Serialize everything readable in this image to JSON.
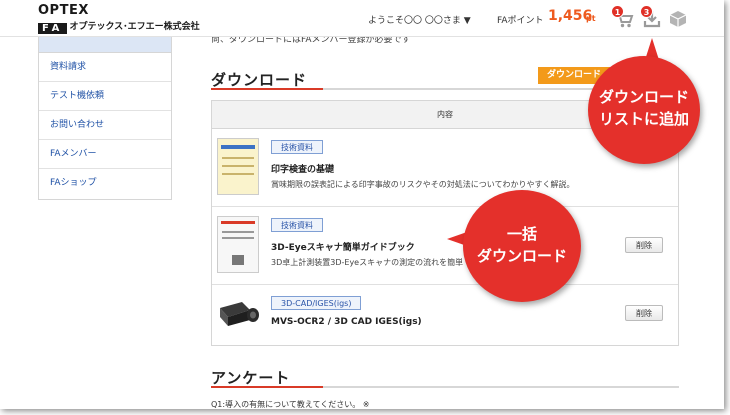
{
  "header": {
    "logo_top": "OPTEX",
    "logo_fa": "FA",
    "company_name": "オプテックス･エフエー株式会社",
    "greeting": "ようこそ〇〇 〇〇さま ▼",
    "points_label": "FAポイント",
    "points_value": "1,456",
    "points_unit": "pt",
    "cart_badge": "1",
    "download_badge": "3",
    "icons": [
      "cart-icon",
      "download-list-icon",
      "box-icon"
    ]
  },
  "sidebar": {
    "items": [
      {
        "label": "資料請求"
      },
      {
        "label": "テスト機依頼"
      },
      {
        "label": "お問い合わせ"
      },
      {
        "label": "FAメンバー"
      },
      {
        "label": "FAショップ"
      }
    ]
  },
  "main": {
    "intro_text": "尚、ダウンロードにはFAメンバー登録が必要です",
    "download_title": "ダウンロード",
    "download_all_button": "ダウンロード",
    "table_header": "内容",
    "items": [
      {
        "tag": "技術資料",
        "title": "印字検査の基礎",
        "description": "賞味期限の誤表記による印字事故のリスクやその対処法についてわかりやすく解説。",
        "delete_label": ""
      },
      {
        "tag": "技術資料",
        "title": "3D-Eyeスキャナ簡単ガイドブック",
        "description": "3D卓上計測装置3D-Eyeスキャナの測定の流れを簡単",
        "delete_label": "削除"
      },
      {
        "tag": "3D-CAD/IGES(igs)",
        "title": "MVS-OCR2 / 3D CAD IGES(igs)",
        "description": "",
        "delete_label": "削除"
      }
    ],
    "survey_title": "アンケート",
    "survey_question": "Q1:導入の有無について教えてください。 ※"
  },
  "callouts": {
    "download_list": {
      "line1": "ダウンロード",
      "line2": "リストに追加"
    },
    "bulk_download": {
      "line1": "一括",
      "line2": "ダウンロード"
    }
  },
  "colors": {
    "accent_red": "#e4302b",
    "orange_button": "#f39a1a",
    "points_orange": "#ee5a1e",
    "link_blue": "#2052a6"
  }
}
